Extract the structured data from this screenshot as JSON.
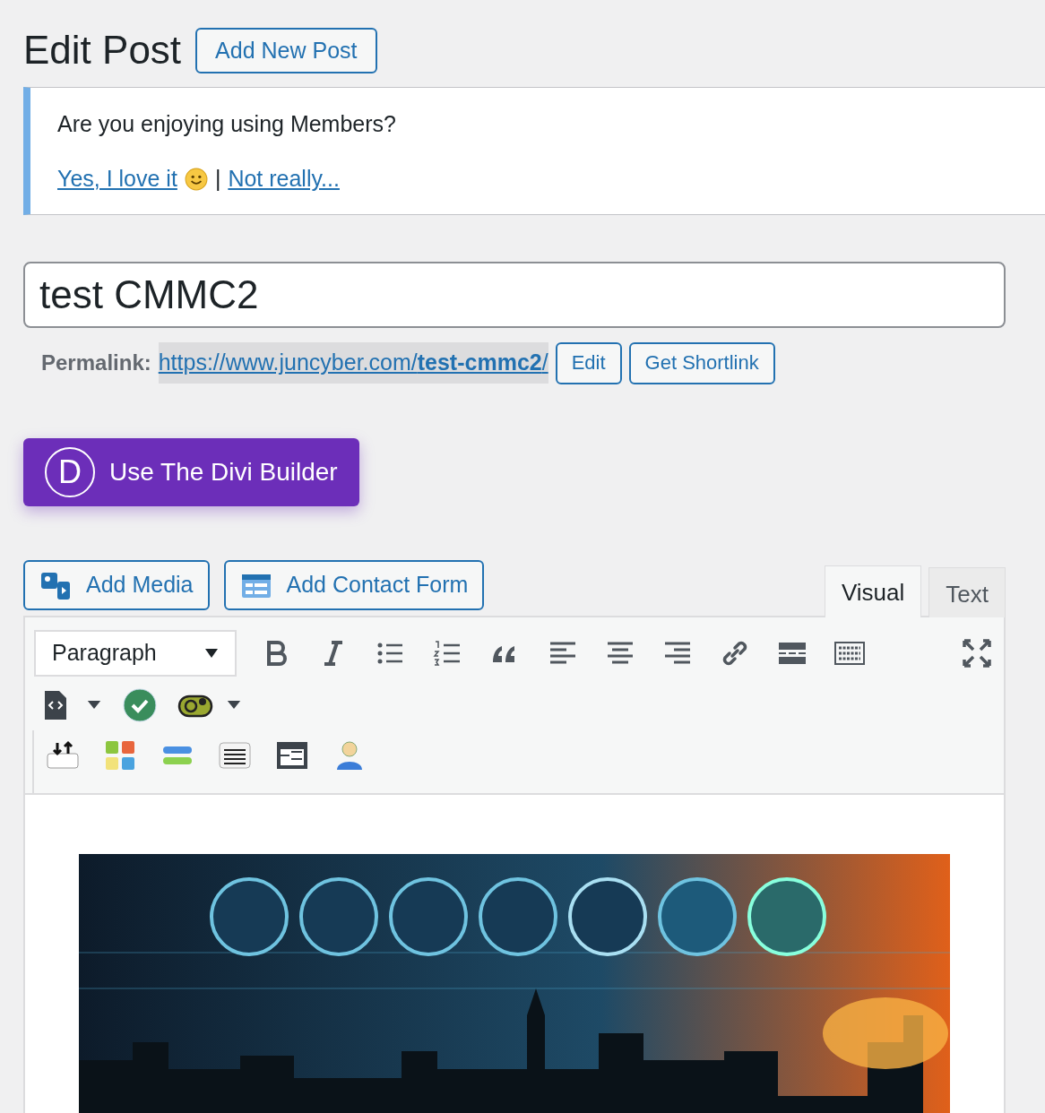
{
  "page": {
    "title": "Edit Post",
    "add_new_button": "Add New Post"
  },
  "notice": {
    "question": "Are you enjoying using Members?",
    "yes_link": "Yes, I love it",
    "separator": "|",
    "no_link": "Not really..."
  },
  "post": {
    "title_value": "test CMMC2",
    "permalink_label": "Permalink:",
    "permalink_url": "https://www.juncyber.com/**test-cmmc2**/",
    "edit_button": "Edit",
    "shortlink_button": "Get Shortlink"
  },
  "divi_button": {
    "icon_letter": "D",
    "label": "Use The Divi Builder"
  },
  "media_buttons": [
    {
      "kind": "media",
      "label": "Add Media"
    },
    {
      "kind": "form",
      "label": "Add Contact Form"
    }
  ],
  "editor_tabs": [
    {
      "label": "Visual",
      "selected": true
    },
    {
      "label": "Text",
      "selected": false
    }
  ],
  "toolbar": {
    "format_select": "Paragraph"
  }
}
